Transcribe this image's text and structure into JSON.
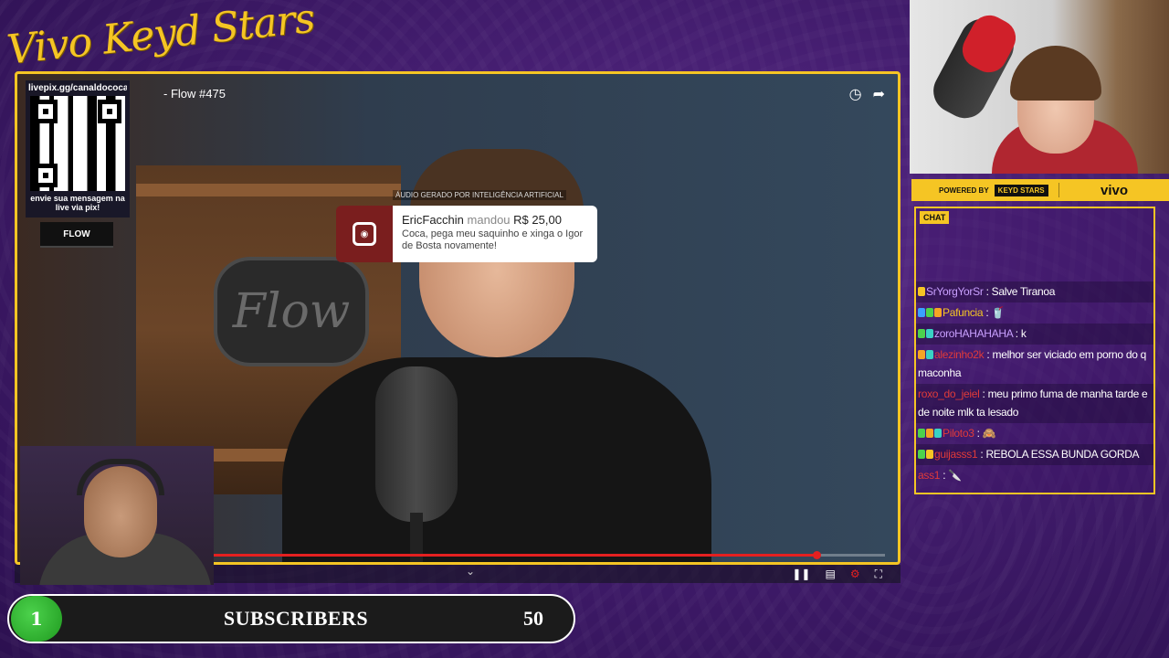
{
  "brand": {
    "script_title": "Vivo Keyd Stars"
  },
  "video": {
    "title": "- Flow #475",
    "progress_fraction": 0.92
  },
  "qr": {
    "url": "livepix.gg/canaldococa",
    "caption": "envie sua mensagem na live via pix!",
    "tag": "FLOW"
  },
  "donation": {
    "ai_note": "ÁUDIO GERADO POR INTELIGÊNCIA ARTIFICIAL",
    "user": "EricFacchin",
    "verb": "mandou",
    "amount": "R$ 25,00",
    "message": "Coca, pega meu saquinho e xinga o Igor de Bosta novamente!"
  },
  "powered": {
    "label": "POWERED BY",
    "logo": "KEYD STARS",
    "sponsor": "vivo"
  },
  "chat": {
    "tag": "CHAT",
    "messages": [
      {
        "user": "SrYorgYorSr",
        "user_color": "#c9a0ff",
        "text": "Salve Tiranoa",
        "badges": [
          "#f5c524"
        ]
      },
      {
        "user": "Pafuncia",
        "user_color": "#f5c524",
        "text": "🥤",
        "badges": [
          "#3aa0ff",
          "#4cd24c",
          "#f5a524"
        ]
      },
      {
        "user": "zoroHAHAHAHA",
        "user_color": "#c9a0ff",
        "text": "k",
        "badges": [
          "#4cd24c",
          "#3ad2c4"
        ]
      },
      {
        "user": "alezinho2k",
        "user_color": "#e03a3a",
        "text": "melhor ser viciado em porno do q maconha",
        "badges": [
          "#f5a524",
          "#3ad2c4"
        ]
      },
      {
        "user": "roxo_do_jeiel",
        "user_color": "#e03a3a",
        "text": "meu primo fuma de manha tarde e de noite mlk ta lesado",
        "badges": []
      },
      {
        "user": "Piloto3",
        "user_color": "#e03a3a",
        "text": "🙈",
        "badges": [
          "#4cd24c",
          "#f5a524",
          "#3ad2c4"
        ]
      },
      {
        "user": "guijasss1",
        "user_color": "#e03a3a",
        "text": "REBOLA ESSA BUNDA GORDA",
        "badges": [
          "#4cd24c",
          "#f5c524"
        ]
      },
      {
        "user": "ass1",
        "user_color": "#e03a3a",
        "text": "🔪",
        "badges": []
      }
    ]
  },
  "subscribers": {
    "current": "1",
    "label": "SUBSCRIBERS",
    "goal": "50"
  },
  "icons": {
    "clock": "clock-icon",
    "share": "share-icon",
    "pause": "pause-icon",
    "captions": "captions-icon",
    "settings": "settings-icon",
    "fullscreen": "fullscreen-icon",
    "chevron": "chevron-down-icon"
  }
}
